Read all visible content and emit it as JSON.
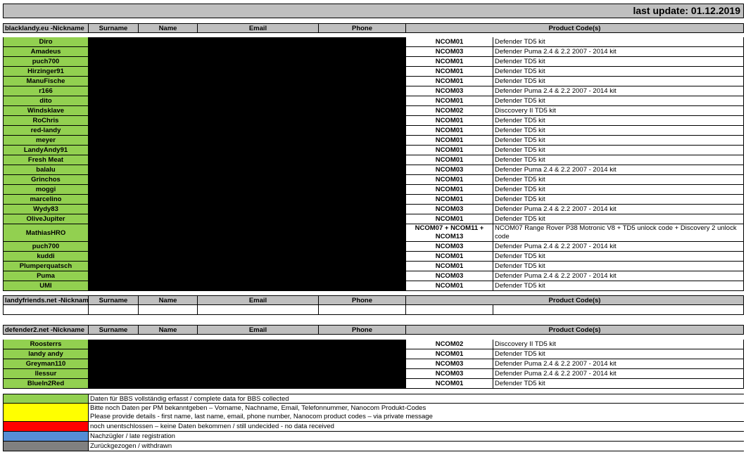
{
  "title": "last update: 01.12.2019",
  "sections": [
    {
      "header": [
        "blacklandy.eu -Nickname",
        "Surname",
        "Name",
        "Email",
        "Phone",
        "Product Code(s)"
      ],
      "rows": [
        {
          "nick": "Diro",
          "code": "NCOM01",
          "product": "Defender TD5 kit"
        },
        {
          "nick": "Amadeus",
          "code": "NCOM03",
          "product": "Defender Puma 2.4 & 2.2 2007 - 2014 kit"
        },
        {
          "nick": "puch700",
          "code": "NCOM01",
          "product": "Defender TD5 kit"
        },
        {
          "nick": "Hirzinger91",
          "code": "NCOM01",
          "product": "Defender TD5 kit"
        },
        {
          "nick": "ManuFische",
          "code": "NCOM01",
          "product": "Defender TD5 kit"
        },
        {
          "nick": "r166",
          "code": "NCOM03",
          "product": "Defender Puma 2.4 & 2.2 2007 - 2014 kit"
        },
        {
          "nick": "dito",
          "code": "NCOM01",
          "product": "Defender TD5 kit"
        },
        {
          "nick": "Windsklave",
          "code": "NCOM02",
          "product": "Disccovery II TD5 kit"
        },
        {
          "nick": "RoChris",
          "code": "NCOM01",
          "product": "Defender TD5 kit"
        },
        {
          "nick": "red-landy",
          "code": "NCOM01",
          "product": "Defender TD5 kit"
        },
        {
          "nick": "meyer",
          "code": "NCOM01",
          "product": "Defender TD5 kit"
        },
        {
          "nick": "LandyAndy91",
          "code": "NCOM01",
          "product": "Defender TD5 kit"
        },
        {
          "nick": "Fresh Meat",
          "code": "NCOM01",
          "product": "Defender TD5 kit"
        },
        {
          "nick": "balalu",
          "code": "NCOM03",
          "product": "Defender Puma 2.4 & 2.2 2007 - 2014 kit"
        },
        {
          "nick": "Grinchos",
          "code": "NCOM01",
          "product": "Defender TD5 kit"
        },
        {
          "nick": "moggi",
          "code": "NCOM01",
          "product": "Defender TD5 kit"
        },
        {
          "nick": "marcelino",
          "code": "NCOM01",
          "product": "Defender TD5 kit"
        },
        {
          "nick": "Wydy83",
          "code": "NCOM03",
          "product": "Defender Puma 2.4 & 2.2 2007 - 2014 kit"
        },
        {
          "nick": "OliveJupiter",
          "code": "NCOM01",
          "product": "Defender TD5 kit"
        },
        {
          "nick": "MathiasHRO",
          "code": "NCOM07 + NCOM11 + NCOM13",
          "product": "NCOM07 Range Rover P38 Motronic V8 + TD5 unlock code + Discovery 2 unlock code",
          "tall": true
        },
        {
          "nick": "puch700",
          "code": "NCOM03",
          "product": "Defender Puma 2.4 & 2.2 2007 - 2014 kit"
        },
        {
          "nick": "kuddi",
          "code": "NCOM01",
          "product": "Defender TD5 kit"
        },
        {
          "nick": "Plumperquatsch",
          "code": "NCOM01",
          "product": "Defender TD5 kit"
        },
        {
          "nick": "Puma",
          "code": "NCOM03",
          "product": "Defender Puma 2.4 & 2.2 2007 - 2014 kit"
        },
        {
          "nick": "UMI",
          "code": "NCOM01",
          "product": "Defender TD5 kit"
        }
      ]
    },
    {
      "header": [
        "landyfriends.net -Nickname",
        "Surname",
        "Name",
        "Email",
        "Phone",
        "Product Code(s)"
      ],
      "rows": []
    },
    {
      "header": [
        "defender2.net -Nickname",
        "Surname",
        "Name",
        "Email",
        "Phone",
        "Product Code(s)"
      ],
      "rows": [
        {
          "nick": "Roosterrs",
          "code": "NCOM02",
          "product": "Disccovery II TD5 kit"
        },
        {
          "nick": "landy andy",
          "code": "NCOM01",
          "product": "Defender TD5 kit"
        },
        {
          "nick": "Greyman110",
          "code": "NCOM03",
          "product": "Defender Puma 2.4 & 2.2 2007 - 2014 kit"
        },
        {
          "nick": "llessur",
          "code": "NCOM03",
          "product": "Defender Puma 2.4 & 2.2 2007 - 2014 kit"
        },
        {
          "nick": "BlueIn2Red",
          "code": "NCOM01",
          "product": "Defender TD5 kit"
        }
      ]
    }
  ],
  "legend": [
    {
      "color": "#92d050",
      "text": "Daten für BBS vollständig erfasst / complete data for BBS collected"
    },
    {
      "color": "#ffff00",
      "text": "Bitte noch Daten per PM bekanntgeben – Vorname, Nachname, Email, Telefonnummer, Nanocom Produkt-Codes",
      "text2": "Please provide details - first name, last name, email, phone number, Nanocom product codes – via private message"
    },
    {
      "color": "#ff0000",
      "text": "noch unentschlossen – keine Daten bekommen / still undecided - no data received"
    },
    {
      "color": "#558ed5",
      "text": "Nachzügler / late registration"
    },
    {
      "color": "#808080",
      "text": "Zurückgezogen / withdrawn"
    }
  ]
}
